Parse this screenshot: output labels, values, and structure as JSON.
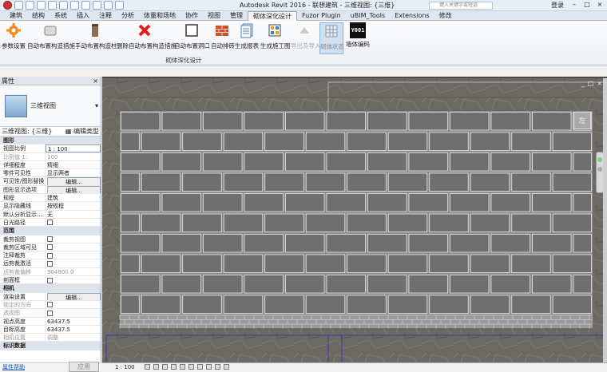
{
  "app": {
    "title": "Autodesk Revit 2016 -   联想建筑 - 三维视图: {三维}",
    "search_placeholder": "键入关键字或短语",
    "user_label": "登录"
  },
  "tabs": [
    "建筑",
    "结构",
    "系统",
    "插入",
    "注释",
    "分析",
    "体量和场地",
    "协作",
    "视图",
    "管理",
    "砌体深化设计",
    "Fuzor Plugin",
    "uBIM_Tools",
    "Extensions",
    "修改"
  ],
  "active_tab": "砌体深化设计",
  "ribbon": {
    "buttons": [
      {
        "label": "参数设置",
        "icon": "gear-icon"
      },
      {
        "label": "自动布置构造措施",
        "icon": "block-icon"
      },
      {
        "label": "手动布置构造柱",
        "icon": "column-icon"
      },
      {
        "label": "删除自动布置构造措施",
        "icon": "red-x-icon"
      },
      {
        "label": "自动布置洞口",
        "icon": "opening-icon"
      },
      {
        "label": "自动排砖",
        "icon": "brick-icon"
      },
      {
        "label": "生成报表",
        "icon": "report-icon"
      },
      {
        "label": "生成施工图",
        "icon": "drawing-icon"
      },
      {
        "label": "导出及导入",
        "icon": "export-icon"
      },
      {
        "label": "砌体状态",
        "icon": "grid-icon"
      },
      {
        "label": "墙体编码",
        "icon": "code-icon"
      }
    ],
    "panel_label": "砌体深化设计",
    "code_icon_text": "Y001"
  },
  "properties": {
    "header": "属性",
    "close": "×",
    "type_name": "三维视图",
    "type_selector": "三维视图: {三维}",
    "edit_type": "编辑类型",
    "rows": [
      {
        "group": true,
        "k": "图形"
      },
      {
        "k": "视图比例",
        "v": "1 : 100",
        "input": true
      },
      {
        "k": "比例值 1:",
        "v": "100",
        "dim": true
      },
      {
        "k": "详细程度",
        "v": "精细"
      },
      {
        "k": "零件可见性",
        "v": "显示两者"
      },
      {
        "k": "可见性/图形替换",
        "v": "编辑...",
        "btn": true
      },
      {
        "k": "图形显示选项",
        "v": "编辑...",
        "btn": true
      },
      {
        "k": "规程",
        "v": "建筑"
      },
      {
        "k": "显示隐藏线",
        "v": "按规程"
      },
      {
        "k": "默认分析显示...",
        "v": "无"
      },
      {
        "k": "日光路径",
        "v": "",
        "check": true
      },
      {
        "group": true,
        "k": "范围"
      },
      {
        "k": "裁剪视图",
        "v": "",
        "check": true
      },
      {
        "k": "裁剪区域可见",
        "v": "",
        "check": true
      },
      {
        "k": "注释裁剪",
        "v": "",
        "check": true
      },
      {
        "k": "远剪裁激活",
        "v": "",
        "check": true
      },
      {
        "k": "远剪裁偏移",
        "v": "304800.0",
        "dim": true
      },
      {
        "k": "剖面框",
        "v": "",
        "check": true
      },
      {
        "group": true,
        "k": "相机"
      },
      {
        "k": "渲染设置",
        "v": "编辑...",
        "btn": true
      },
      {
        "k": "锁定的方向",
        "v": "",
        "check": true,
        "dim": true
      },
      {
        "k": "透视图",
        "v": "",
        "check": true,
        "dim": true
      },
      {
        "k": "视点高度",
        "v": "63437.5"
      },
      {
        "k": "目标高度",
        "v": "63437.5"
      },
      {
        "k": "相机位置",
        "v": "调整",
        "dim": true
      },
      {
        "group": true,
        "k": "标识数据"
      }
    ],
    "help_link": "属性帮助",
    "apply": "应用"
  },
  "viewcube_face": "左",
  "status": {
    "scale": "1 : 100"
  }
}
